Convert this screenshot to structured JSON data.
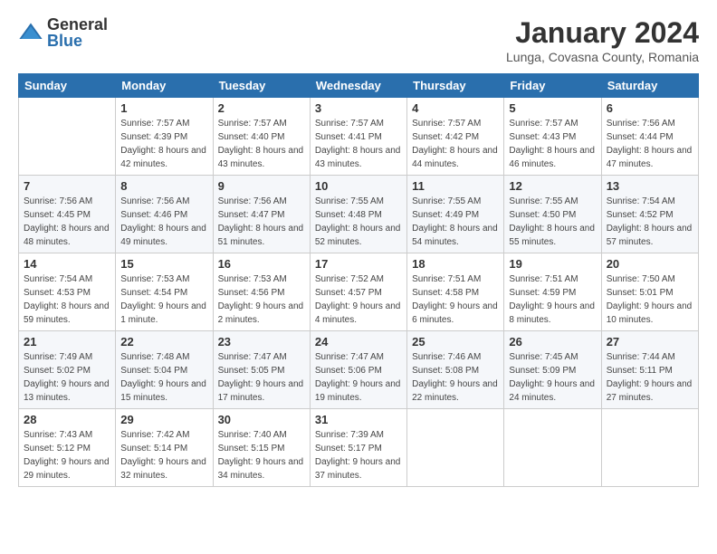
{
  "logo": {
    "general": "General",
    "blue": "Blue"
  },
  "title": "January 2024",
  "location": "Lunga, Covasna County, Romania",
  "days_header": [
    "Sunday",
    "Monday",
    "Tuesday",
    "Wednesday",
    "Thursday",
    "Friday",
    "Saturday"
  ],
  "weeks": [
    [
      {
        "day": "",
        "sunrise": "",
        "sunset": "",
        "daylight": ""
      },
      {
        "day": "1",
        "sunrise": "Sunrise: 7:57 AM",
        "sunset": "Sunset: 4:39 PM",
        "daylight": "Daylight: 8 hours and 42 minutes."
      },
      {
        "day": "2",
        "sunrise": "Sunrise: 7:57 AM",
        "sunset": "Sunset: 4:40 PM",
        "daylight": "Daylight: 8 hours and 43 minutes."
      },
      {
        "day": "3",
        "sunrise": "Sunrise: 7:57 AM",
        "sunset": "Sunset: 4:41 PM",
        "daylight": "Daylight: 8 hours and 43 minutes."
      },
      {
        "day": "4",
        "sunrise": "Sunrise: 7:57 AM",
        "sunset": "Sunset: 4:42 PM",
        "daylight": "Daylight: 8 hours and 44 minutes."
      },
      {
        "day": "5",
        "sunrise": "Sunrise: 7:57 AM",
        "sunset": "Sunset: 4:43 PM",
        "daylight": "Daylight: 8 hours and 46 minutes."
      },
      {
        "day": "6",
        "sunrise": "Sunrise: 7:56 AM",
        "sunset": "Sunset: 4:44 PM",
        "daylight": "Daylight: 8 hours and 47 minutes."
      }
    ],
    [
      {
        "day": "7",
        "sunrise": "Sunrise: 7:56 AM",
        "sunset": "Sunset: 4:45 PM",
        "daylight": "Daylight: 8 hours and 48 minutes."
      },
      {
        "day": "8",
        "sunrise": "Sunrise: 7:56 AM",
        "sunset": "Sunset: 4:46 PM",
        "daylight": "Daylight: 8 hours and 49 minutes."
      },
      {
        "day": "9",
        "sunrise": "Sunrise: 7:56 AM",
        "sunset": "Sunset: 4:47 PM",
        "daylight": "Daylight: 8 hours and 51 minutes."
      },
      {
        "day": "10",
        "sunrise": "Sunrise: 7:55 AM",
        "sunset": "Sunset: 4:48 PM",
        "daylight": "Daylight: 8 hours and 52 minutes."
      },
      {
        "day": "11",
        "sunrise": "Sunrise: 7:55 AM",
        "sunset": "Sunset: 4:49 PM",
        "daylight": "Daylight: 8 hours and 54 minutes."
      },
      {
        "day": "12",
        "sunrise": "Sunrise: 7:55 AM",
        "sunset": "Sunset: 4:50 PM",
        "daylight": "Daylight: 8 hours and 55 minutes."
      },
      {
        "day": "13",
        "sunrise": "Sunrise: 7:54 AM",
        "sunset": "Sunset: 4:52 PM",
        "daylight": "Daylight: 8 hours and 57 minutes."
      }
    ],
    [
      {
        "day": "14",
        "sunrise": "Sunrise: 7:54 AM",
        "sunset": "Sunset: 4:53 PM",
        "daylight": "Daylight: 8 hours and 59 minutes."
      },
      {
        "day": "15",
        "sunrise": "Sunrise: 7:53 AM",
        "sunset": "Sunset: 4:54 PM",
        "daylight": "Daylight: 9 hours and 1 minute."
      },
      {
        "day": "16",
        "sunrise": "Sunrise: 7:53 AM",
        "sunset": "Sunset: 4:56 PM",
        "daylight": "Daylight: 9 hours and 2 minutes."
      },
      {
        "day": "17",
        "sunrise": "Sunrise: 7:52 AM",
        "sunset": "Sunset: 4:57 PM",
        "daylight": "Daylight: 9 hours and 4 minutes."
      },
      {
        "day": "18",
        "sunrise": "Sunrise: 7:51 AM",
        "sunset": "Sunset: 4:58 PM",
        "daylight": "Daylight: 9 hours and 6 minutes."
      },
      {
        "day": "19",
        "sunrise": "Sunrise: 7:51 AM",
        "sunset": "Sunset: 4:59 PM",
        "daylight": "Daylight: 9 hours and 8 minutes."
      },
      {
        "day": "20",
        "sunrise": "Sunrise: 7:50 AM",
        "sunset": "Sunset: 5:01 PM",
        "daylight": "Daylight: 9 hours and 10 minutes."
      }
    ],
    [
      {
        "day": "21",
        "sunrise": "Sunrise: 7:49 AM",
        "sunset": "Sunset: 5:02 PM",
        "daylight": "Daylight: 9 hours and 13 minutes."
      },
      {
        "day": "22",
        "sunrise": "Sunrise: 7:48 AM",
        "sunset": "Sunset: 5:04 PM",
        "daylight": "Daylight: 9 hours and 15 minutes."
      },
      {
        "day": "23",
        "sunrise": "Sunrise: 7:47 AM",
        "sunset": "Sunset: 5:05 PM",
        "daylight": "Daylight: 9 hours and 17 minutes."
      },
      {
        "day": "24",
        "sunrise": "Sunrise: 7:47 AM",
        "sunset": "Sunset: 5:06 PM",
        "daylight": "Daylight: 9 hours and 19 minutes."
      },
      {
        "day": "25",
        "sunrise": "Sunrise: 7:46 AM",
        "sunset": "Sunset: 5:08 PM",
        "daylight": "Daylight: 9 hours and 22 minutes."
      },
      {
        "day": "26",
        "sunrise": "Sunrise: 7:45 AM",
        "sunset": "Sunset: 5:09 PM",
        "daylight": "Daylight: 9 hours and 24 minutes."
      },
      {
        "day": "27",
        "sunrise": "Sunrise: 7:44 AM",
        "sunset": "Sunset: 5:11 PM",
        "daylight": "Daylight: 9 hours and 27 minutes."
      }
    ],
    [
      {
        "day": "28",
        "sunrise": "Sunrise: 7:43 AM",
        "sunset": "Sunset: 5:12 PM",
        "daylight": "Daylight: 9 hours and 29 minutes."
      },
      {
        "day": "29",
        "sunrise": "Sunrise: 7:42 AM",
        "sunset": "Sunset: 5:14 PM",
        "daylight": "Daylight: 9 hours and 32 minutes."
      },
      {
        "day": "30",
        "sunrise": "Sunrise: 7:40 AM",
        "sunset": "Sunset: 5:15 PM",
        "daylight": "Daylight: 9 hours and 34 minutes."
      },
      {
        "day": "31",
        "sunrise": "Sunrise: 7:39 AM",
        "sunset": "Sunset: 5:17 PM",
        "daylight": "Daylight: 9 hours and 37 minutes."
      },
      {
        "day": "",
        "sunrise": "",
        "sunset": "",
        "daylight": ""
      },
      {
        "day": "",
        "sunrise": "",
        "sunset": "",
        "daylight": ""
      },
      {
        "day": "",
        "sunrise": "",
        "sunset": "",
        "daylight": ""
      }
    ]
  ]
}
